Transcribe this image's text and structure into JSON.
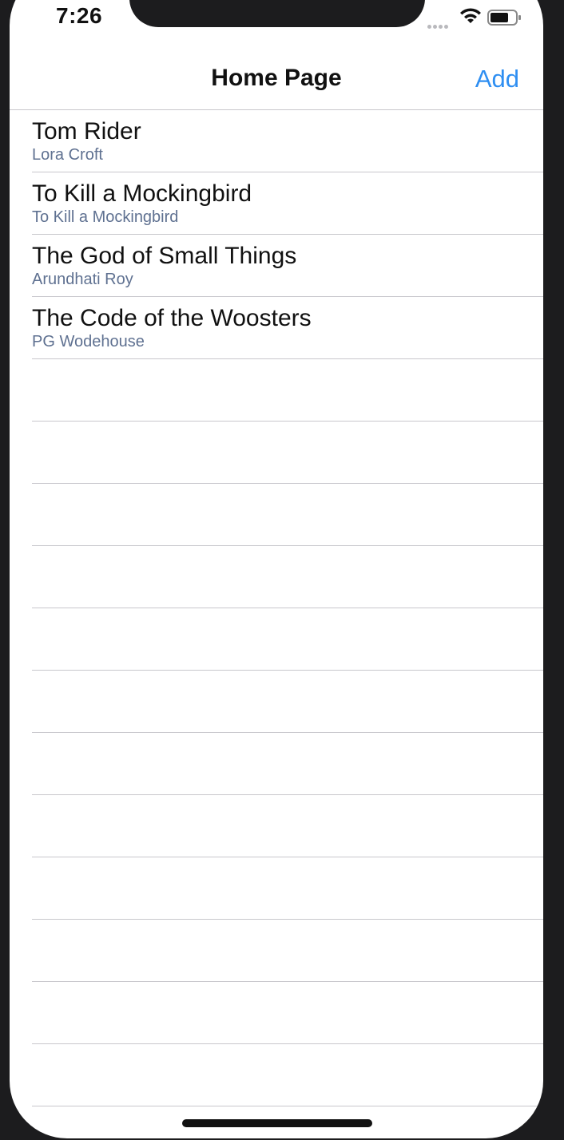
{
  "status_bar": {
    "time": "7:26"
  },
  "nav": {
    "title": "Home Page",
    "add_label": "Add"
  },
  "books": [
    {
      "title": "Tom Rider",
      "author": "Lora Croft"
    },
    {
      "title": "To Kill a Mockingbird",
      "author": "To Kill a Mockingbird"
    },
    {
      "title": "The God of Small Things",
      "author": "Arundhati Roy"
    },
    {
      "title": "The Code of the Woosters",
      "author": "PG Wodehouse"
    }
  ],
  "colors": {
    "accent": "#2f8ff2",
    "subtitle": "#5f7191",
    "separator": "#c8c7cc",
    "frame": "#1c1c1e"
  },
  "icons": [
    "cellular-signal-icon",
    "wifi-icon",
    "battery-icon"
  ]
}
